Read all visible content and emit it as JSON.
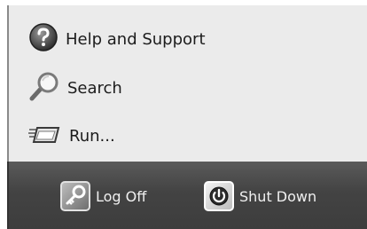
{
  "menu": {
    "items": [
      {
        "label": "Help and Support",
        "icon": "help-icon"
      },
      {
        "label": "Search",
        "icon": "search-icon"
      },
      {
        "label": "Run...",
        "icon": "run-icon"
      }
    ]
  },
  "bottom_bar": {
    "log_off_label": "Log Off",
    "log_off_icon": "key-icon",
    "shut_down_label": "Shut Down",
    "shut_down_icon": "power-icon"
  },
  "colors": {
    "menu_background": "#ebebeb",
    "bottom_bar_background": "#434343"
  }
}
